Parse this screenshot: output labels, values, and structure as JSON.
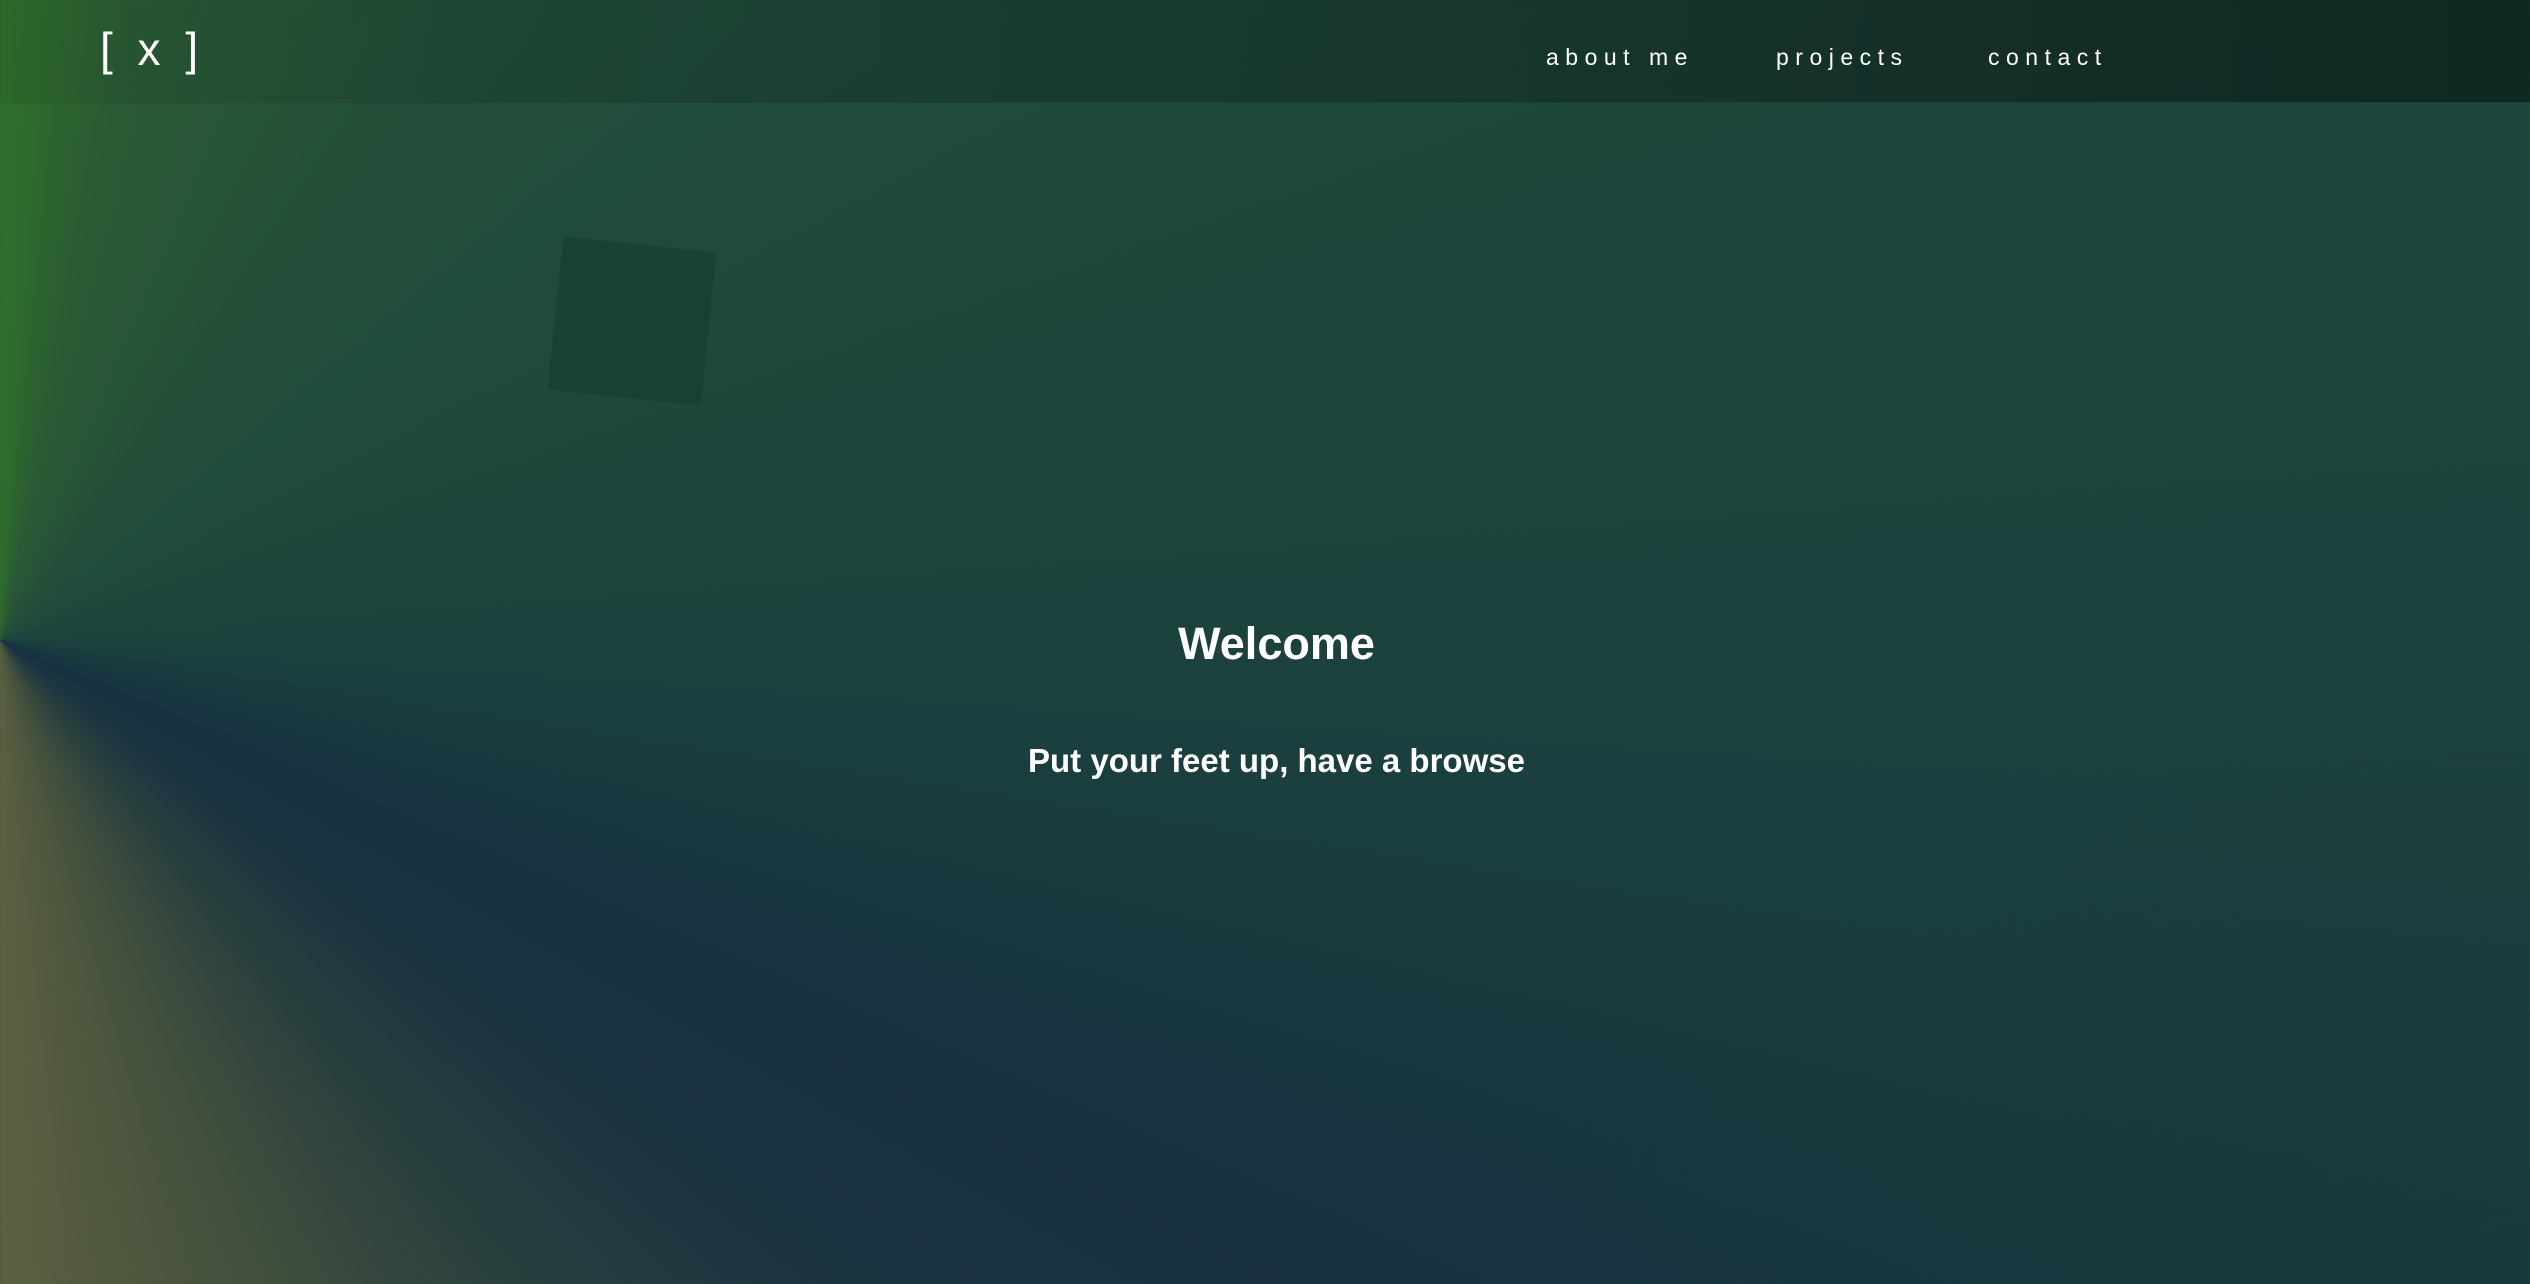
{
  "header": {
    "logo_text": "[ x ]",
    "nav": [
      {
        "label": "about me"
      },
      {
        "label": "projects"
      },
      {
        "label": "contact"
      }
    ]
  },
  "hero": {
    "title": "Welcome",
    "subtitle": "Put your feet up, have a browse"
  },
  "colors": {
    "text": "#ffffff",
    "bg_green": "#2f6f2a",
    "bg_teal": "#1d443d",
    "bg_navy": "#173042",
    "bg_olive": "#5c6040"
  }
}
